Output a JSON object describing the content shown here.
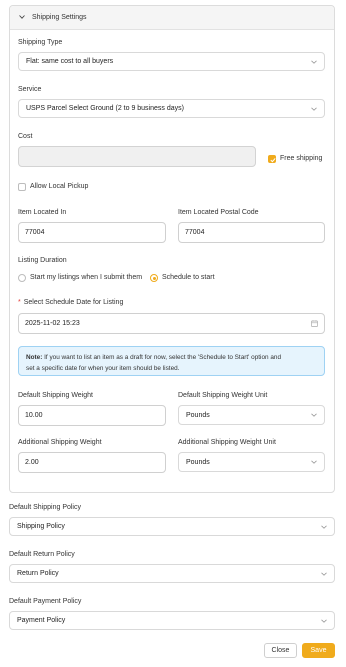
{
  "panel": {
    "title": "Shipping Settings",
    "shipping_type": {
      "label": "Shipping Type",
      "value": "Flat: same cost to all buyers"
    },
    "service": {
      "label": "Service",
      "value": "USPS Parcel Select Ground (2 to 9 business days)"
    },
    "cost": {
      "label": "Cost",
      "value": "",
      "free_shipping_label": "Free shipping",
      "free_shipping_checked": true
    },
    "local_pickup": {
      "label": "Allow Local Pickup",
      "checked": false
    },
    "item_located_in": {
      "label": "Item Located In",
      "value": "77004"
    },
    "postal_code": {
      "label": "Item Located Postal Code",
      "value": "77004"
    },
    "listing_duration": {
      "label": "Listing Duration",
      "options": [
        "Start my listings when I submit them",
        "Schedule to start"
      ],
      "selected": "Schedule to start"
    },
    "schedule_date": {
      "label": "Select Schedule Date for Listing",
      "value": "2025-11-02 15:23"
    },
    "note": {
      "prefix": "Note:",
      "line1": " If you want to list an item as a draft for now, select the 'Schedule to Start' option and",
      "line2": "set a specific date for when your item should be listed."
    },
    "default_weight": {
      "label": "Default Shipping Weight",
      "value": "10.00"
    },
    "default_weight_unit": {
      "label": "Default Shipping Weight Unit",
      "value": "Pounds"
    },
    "additional_weight": {
      "label": "Additional Shipping Weight",
      "value": "2.00"
    },
    "additional_weight_unit": {
      "label": "Additional Shipping Weight Unit",
      "value": "Pounds"
    }
  },
  "policies": {
    "shipping": {
      "label": "Default Shipping Policy",
      "value": "Shipping Policy"
    },
    "return": {
      "label": "Default Return Policy",
      "value": "Return Policy"
    },
    "payment": {
      "label": "Default Payment Policy",
      "value": "Payment Policy"
    }
  },
  "footer": {
    "close_label": "Close",
    "save_label": "Save"
  },
  "colors": {
    "accent": "#f0ab1c",
    "note_bg": "#e6f4fd",
    "note_border": "#9fd2f3",
    "required": "#e53935"
  }
}
